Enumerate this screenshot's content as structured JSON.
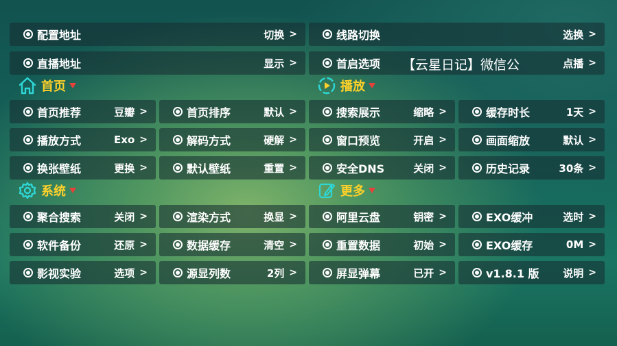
{
  "top": [
    {
      "label": "配置地址",
      "value": "切换"
    },
    {
      "label": "线路切换",
      "value": "选换"
    },
    {
      "label": "直播地址",
      "value": "显示"
    },
    {
      "label": "首启选项",
      "value": "点播"
    }
  ],
  "overlay_text": "【云星日记】微信公",
  "sections": {
    "home": {
      "title": "首页",
      "icon": "home-icon"
    },
    "play": {
      "title": "播放",
      "icon": "play-icon"
    },
    "system": {
      "title": "系统",
      "icon": "gear-icon"
    },
    "more": {
      "title": "更多",
      "icon": "edit-icon"
    }
  },
  "grid1": [
    [
      {
        "label": "首页推荐",
        "value": "豆瓣"
      },
      {
        "label": "首页排序",
        "value": "默认"
      },
      {
        "label": "搜索展示",
        "value": "缩略"
      },
      {
        "label": "缓存时长",
        "value": "1天"
      }
    ],
    [
      {
        "label": "播放方式",
        "value": "Exo"
      },
      {
        "label": "解码方式",
        "value": "硬解"
      },
      {
        "label": "窗口预览",
        "value": "开启"
      },
      {
        "label": "画面缩放",
        "value": "默认"
      }
    ],
    [
      {
        "label": "换张壁纸",
        "value": "更换"
      },
      {
        "label": "默认壁纸",
        "value": "重置"
      },
      {
        "label": "安全DNS",
        "value": "关闭"
      },
      {
        "label": "历史记录",
        "value": "30条"
      }
    ]
  ],
  "grid2": [
    [
      {
        "label": "聚合搜索",
        "value": "关闭"
      },
      {
        "label": "渲染方式",
        "value": "换显"
      },
      {
        "label": "阿里云盘",
        "value": "钥密"
      },
      {
        "label": "EXO缓冲",
        "value": "选时"
      }
    ],
    [
      {
        "label": "软件备份",
        "value": "还原"
      },
      {
        "label": "数据缓存",
        "value": "清空"
      },
      {
        "label": "重置数据",
        "value": "初始"
      },
      {
        "label": "EXO缓存",
        "value": "0M"
      }
    ],
    [
      {
        "label": "影视实验",
        "value": "选项"
      },
      {
        "label": "源显列数",
        "value": "2列"
      },
      {
        "label": "屏显弹幕",
        "value": "已开"
      },
      {
        "label": "v1.8.1 版",
        "value": "说明"
      }
    ]
  ],
  "colors": {
    "accent": "#ffd12a",
    "indicator": "#e8413a",
    "icon": "#2fd6d6"
  }
}
